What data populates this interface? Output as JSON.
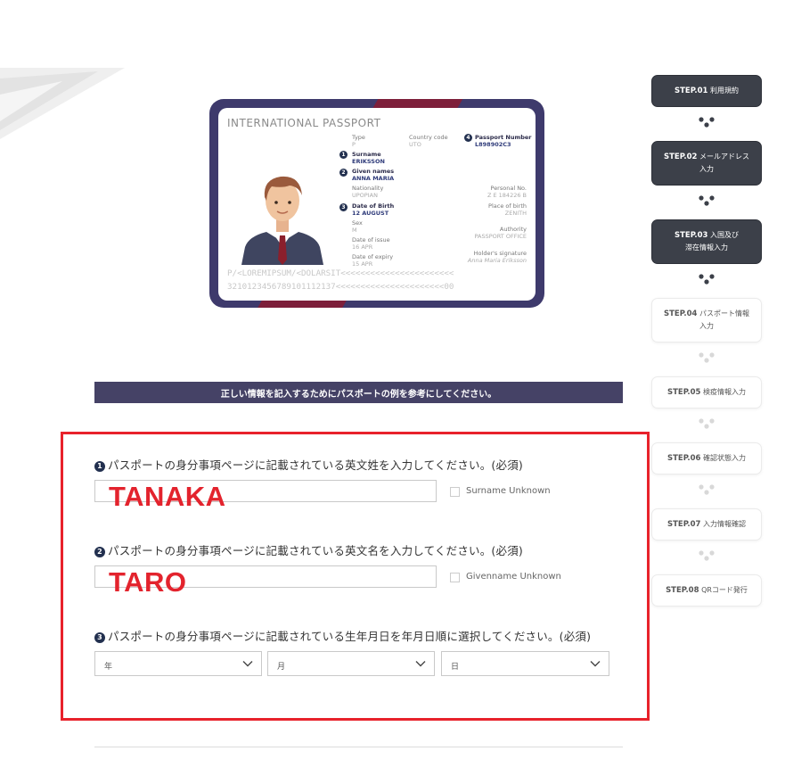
{
  "passport": {
    "title": "INTERNATIONAL PASSPORT",
    "fields": {
      "type_label": "Type",
      "type_value": "P",
      "country_label": "Country code",
      "country_value": "UTO",
      "passport_number_label": "Passport Number",
      "passport_number_value": "L898902C3",
      "surname_label": "Surname",
      "surname_value": "ERIKSSON",
      "given_label": "Given names",
      "given_value": "ANNA MARIA",
      "nationality_label": "Nationality",
      "nationality_value": "UPOPIAN",
      "personal_label": "Personal No.",
      "personal_value": "Z E 184226 B",
      "dob_label": "Date of Birth",
      "dob_value": "12 AUGUST",
      "pob_label": "Place of birth",
      "pob_value": "ZENITH",
      "sex_label": "Sex",
      "sex_value": "M",
      "authority_label": "Authority",
      "authority_value": "PASSPORT OFFICE",
      "issue_label": "Date of issue",
      "issue_value": "16 APR",
      "expiry_label": "Date of expiry",
      "expiry_value": "15 APR",
      "signature_label": "Holder's signature",
      "signature_value": "Anna Maria Eriksson"
    },
    "markers": [
      "1",
      "2",
      "3",
      "4"
    ],
    "mrz_line1": "P/<LOREMIPSUM/<DOLARSIT<<<<<<<<<<<<<<<<<<<<<<<",
    "mrz_line2": "3210123456789101112137<<<<<<<<<<<<<<<<<<<<<<00"
  },
  "notice": "正しい情報を記入するためにパスポートの例を参考にしてください。",
  "questions": [
    {
      "num": "1",
      "text": "パスポートの身分事項ページに記載されている英文姓を入力してください。(必須)",
      "value": "TANAKA",
      "checkbox_label": "Surname Unknown"
    },
    {
      "num": "2",
      "text": "パスポートの身分事項ページに記載されている英文名を入力してください。(必須)",
      "value": "TARO",
      "checkbox_label": "Givenname Unknown"
    },
    {
      "num": "3",
      "text": "パスポートの身分事項ページに記載されている生年月日を年月日順に選択してください。(必須)",
      "selects": [
        "年",
        "月",
        "日"
      ]
    }
  ],
  "steps": [
    {
      "num": "STEP.01",
      "label": "利用規約",
      "label2": "",
      "done": true
    },
    {
      "num": "STEP.02",
      "label": "メールアドレス",
      "label2": "入力",
      "done": true
    },
    {
      "num": "STEP.03",
      "label": "入国及び",
      "label2": "滞在情報入力",
      "done": true
    },
    {
      "num": "STEP.04",
      "label": "パスポート情報",
      "label2": "入力",
      "done": false
    },
    {
      "num": "STEP.05",
      "label": "検疫情報入力",
      "label2": "",
      "done": false
    },
    {
      "num": "STEP.06",
      "label": "確認状態入力",
      "label2": "",
      "done": false
    },
    {
      "num": "STEP.07",
      "label": "入力情報確認",
      "label2": "",
      "done": false
    },
    {
      "num": "STEP.08",
      "label": "QRコード発行",
      "label2": "",
      "done": false
    }
  ],
  "colors": {
    "accent_navy": "#454266",
    "passport_border": "#3e3a6c",
    "passport_maroon": "#7d1f3a",
    "highlight_red": "#e8222b",
    "step_done": "#3c4049"
  }
}
